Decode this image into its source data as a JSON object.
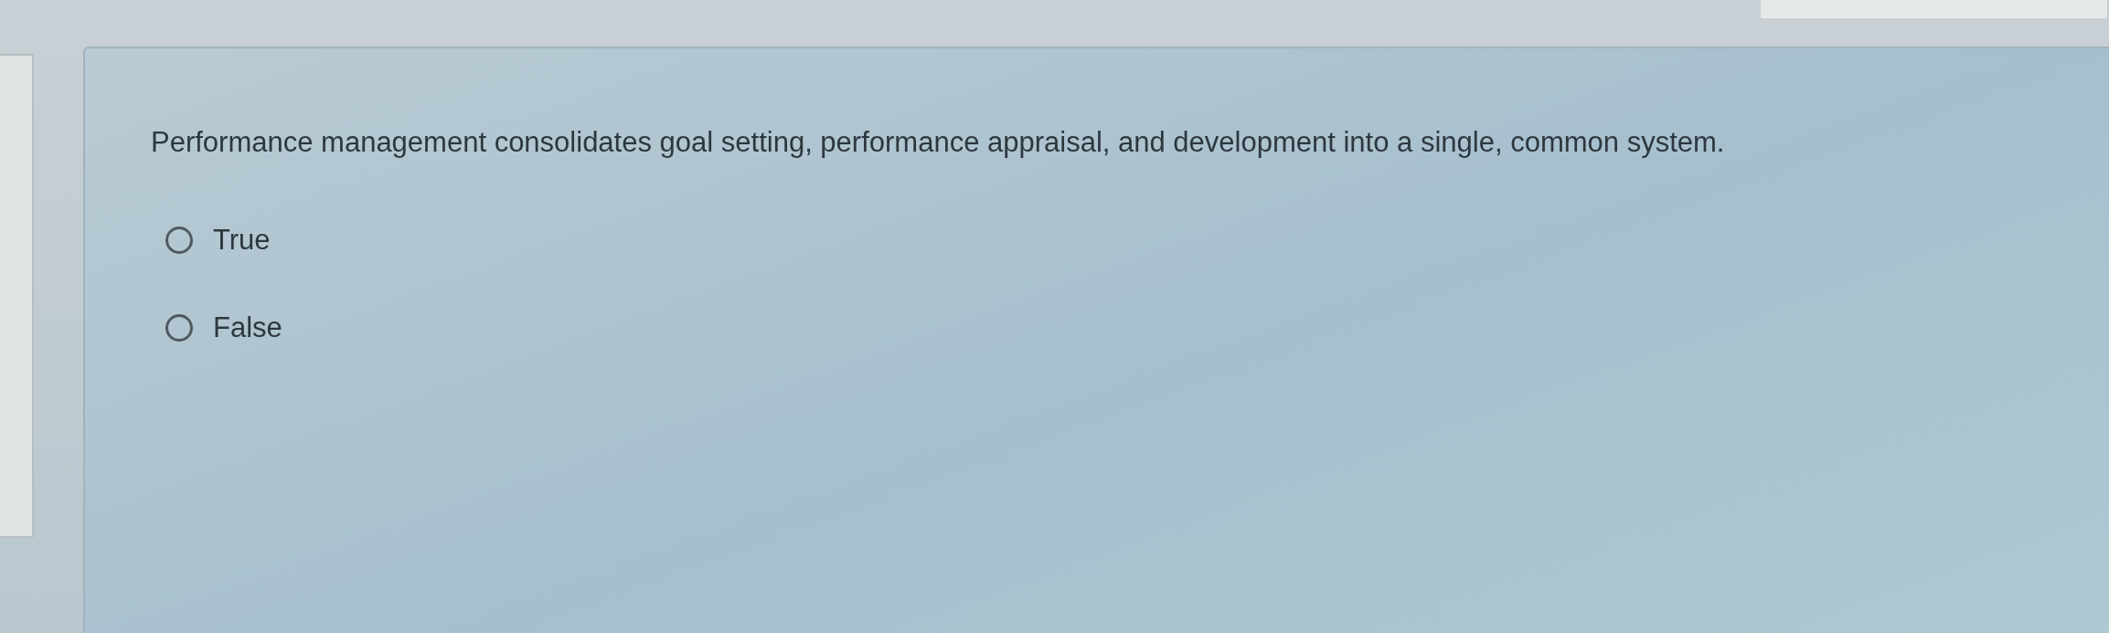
{
  "question": {
    "text": "Performance management consolidates goal setting, performance appraisal, and development into a single, common system.",
    "options": [
      {
        "label": "True",
        "selected": false
      },
      {
        "label": "False",
        "selected": false
      }
    ]
  }
}
